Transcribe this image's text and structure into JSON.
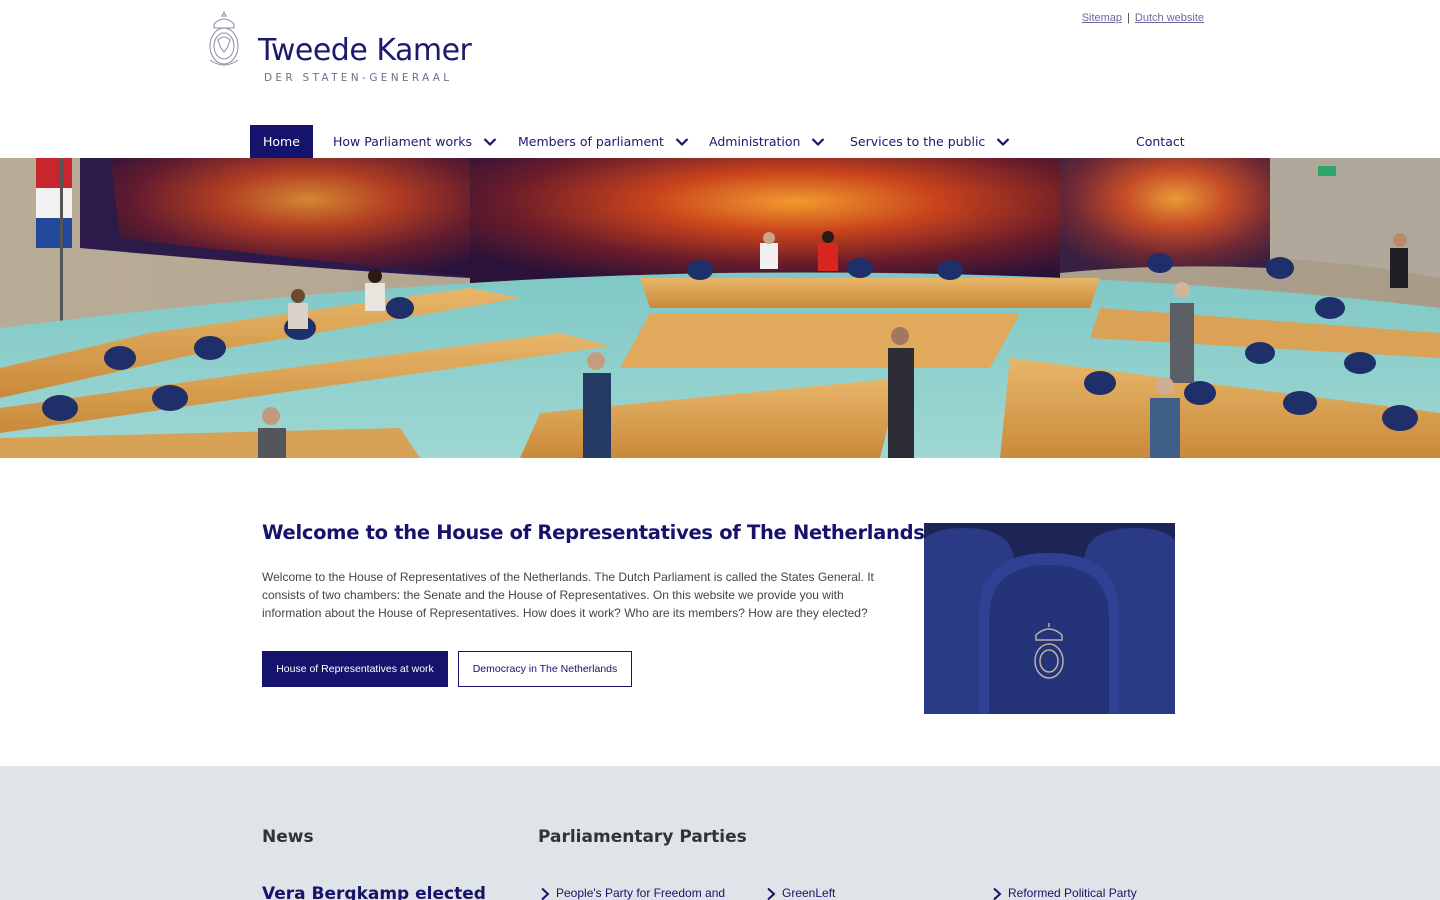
{
  "header": {
    "logo_title": "Tweede Kamer",
    "logo_subtitle": "DER STATEN-GENERAAL",
    "toplinks": {
      "sitemap": "Sitemap",
      "separator": "|",
      "dutch": "Dutch website"
    }
  },
  "nav": {
    "items": [
      {
        "label": "Home",
        "active": true
      },
      {
        "label": "How Parliament works",
        "dropdown": true
      },
      {
        "label": "Members of parliament",
        "dropdown": true
      },
      {
        "label": "Administration",
        "dropdown": true
      },
      {
        "label": "Services to the public",
        "dropdown": true
      },
      {
        "label": "Contact"
      }
    ]
  },
  "intro": {
    "title": "Welcome to the House of Representatives of The Netherlands.",
    "text": "Welcome to the House of Representatives of the Netherlands. The Dutch Parliament is called the States General. It consists of two chambers: the Senate and the House of Representatives. On this website we provide you with information about the House of Representatives. How does it work? Who are its members? How are they elected?",
    "button_primary": "House of Representatives at work",
    "button_secondary": "Democracy in The Netherlands"
  },
  "news": {
    "title": "News",
    "headline": "Vera Bergkamp elected"
  },
  "parties": {
    "title": "Parliamentary Parties",
    "items": [
      "People's Party for Freedom and",
      "GreenLeft",
      "Reformed Political Party"
    ]
  },
  "colors": {
    "brand": "#15136b",
    "band": "#dfe4e8"
  }
}
